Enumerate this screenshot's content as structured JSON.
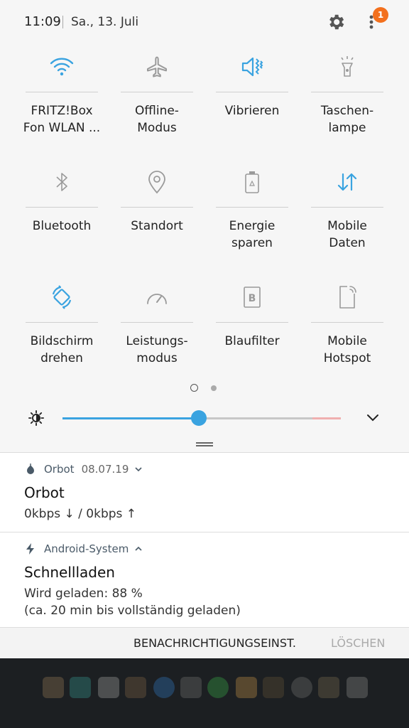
{
  "status": {
    "time": "11:09",
    "date": "Sa., 13. Juli",
    "badge_count": "1"
  },
  "tiles": [
    {
      "label": "FRITZ!Box\nFon WLAN ...",
      "icon": "wifi-icon",
      "active": true
    },
    {
      "label": "Offline-\nModus",
      "icon": "airplane-icon",
      "active": false
    },
    {
      "label": "Vibrieren",
      "icon": "vibrate-icon",
      "active": true
    },
    {
      "label": "Taschen-\nlampe",
      "icon": "flashlight-icon",
      "active": false
    },
    {
      "label": "Bluetooth",
      "icon": "bluetooth-icon",
      "active": false
    },
    {
      "label": "Standort",
      "icon": "location-icon",
      "active": false
    },
    {
      "label": "Energie\nsparen",
      "icon": "battery-saver-icon",
      "active": false
    },
    {
      "label": "Mobile\nDaten",
      "icon": "mobile-data-icon",
      "active": true
    },
    {
      "label": "Bildschirm\ndrehen",
      "icon": "rotate-icon",
      "active": true
    },
    {
      "label": "Leistungs-\nmodus",
      "icon": "performance-icon",
      "active": false
    },
    {
      "label": "Blaufilter",
      "icon": "blue-filter-icon",
      "active": false
    },
    {
      "label": "Mobile\nHotspot",
      "icon": "hotspot-icon",
      "active": false
    }
  ],
  "brightness": {
    "level": 0.49
  },
  "notifications": [
    {
      "app": "Orbot",
      "time": "08.07.19",
      "title": "Orbot",
      "text": "0kbps ↓ / 0kbps ↑"
    },
    {
      "app": "Android-System",
      "title": "Schnellladen",
      "text": "Wird geladen: 88 %\n(ca. 20 min bis vollständig geladen)"
    }
  ],
  "actions": {
    "settings_label": "BENACHRICHTIGUNGSEINST.",
    "clear_label": "LÖSCHEN"
  },
  "colors": {
    "accent": "#3aa3e0",
    "inactive": "#9a9a9a",
    "badge": "#f3701d"
  }
}
